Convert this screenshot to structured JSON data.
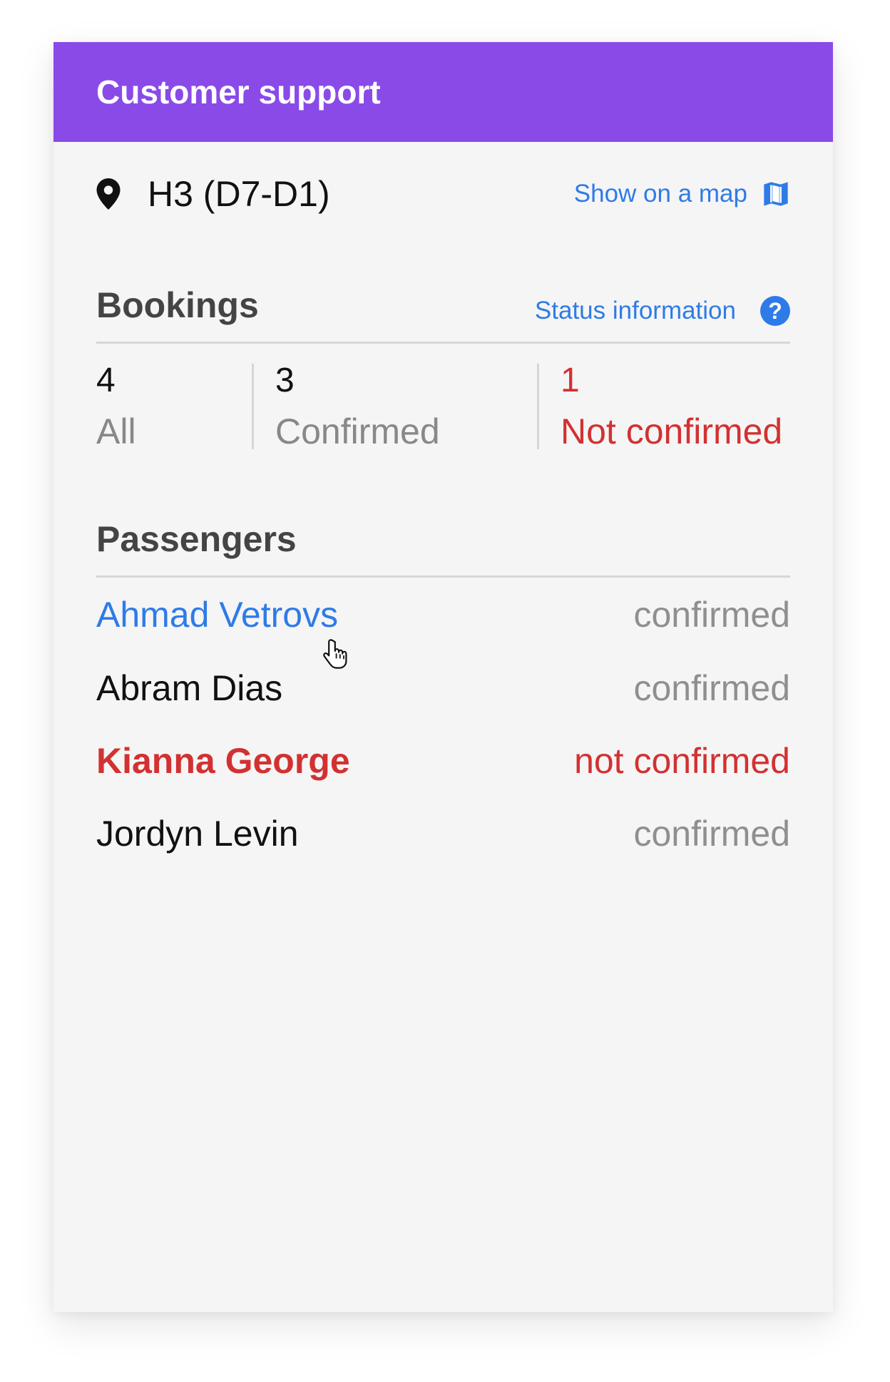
{
  "header": {
    "title": "Customer support"
  },
  "location": {
    "code": "H3 (D7-D1)",
    "pin_icon": "location-pin-icon",
    "map_link_label": "Show on a map",
    "map_icon": "map-icon"
  },
  "bookings": {
    "title": "Bookings",
    "status_link_label": "Status information",
    "help_icon": "question-mark-icon",
    "stats": [
      {
        "count": "4",
        "label": "All"
      },
      {
        "count": "3",
        "label": "Confirmed"
      },
      {
        "count": "1",
        "label": "Not confirmed"
      }
    ]
  },
  "passengers": {
    "title": "Passengers",
    "rows": [
      {
        "name": "Ahmad Vetrovs",
        "status": "confirmed"
      },
      {
        "name": "Abram Dias",
        "status": "confirmed"
      },
      {
        "name": "Kianna George",
        "status": "not confirmed"
      },
      {
        "name": "Jordyn Levin",
        "status": "confirmed"
      }
    ]
  },
  "colors": {
    "header_bg": "#8a4ae8",
    "link": "#2e7be8",
    "alert": "#d33131",
    "card_bg": "#f5f5f5",
    "muted_text": "#8f8f8f"
  }
}
